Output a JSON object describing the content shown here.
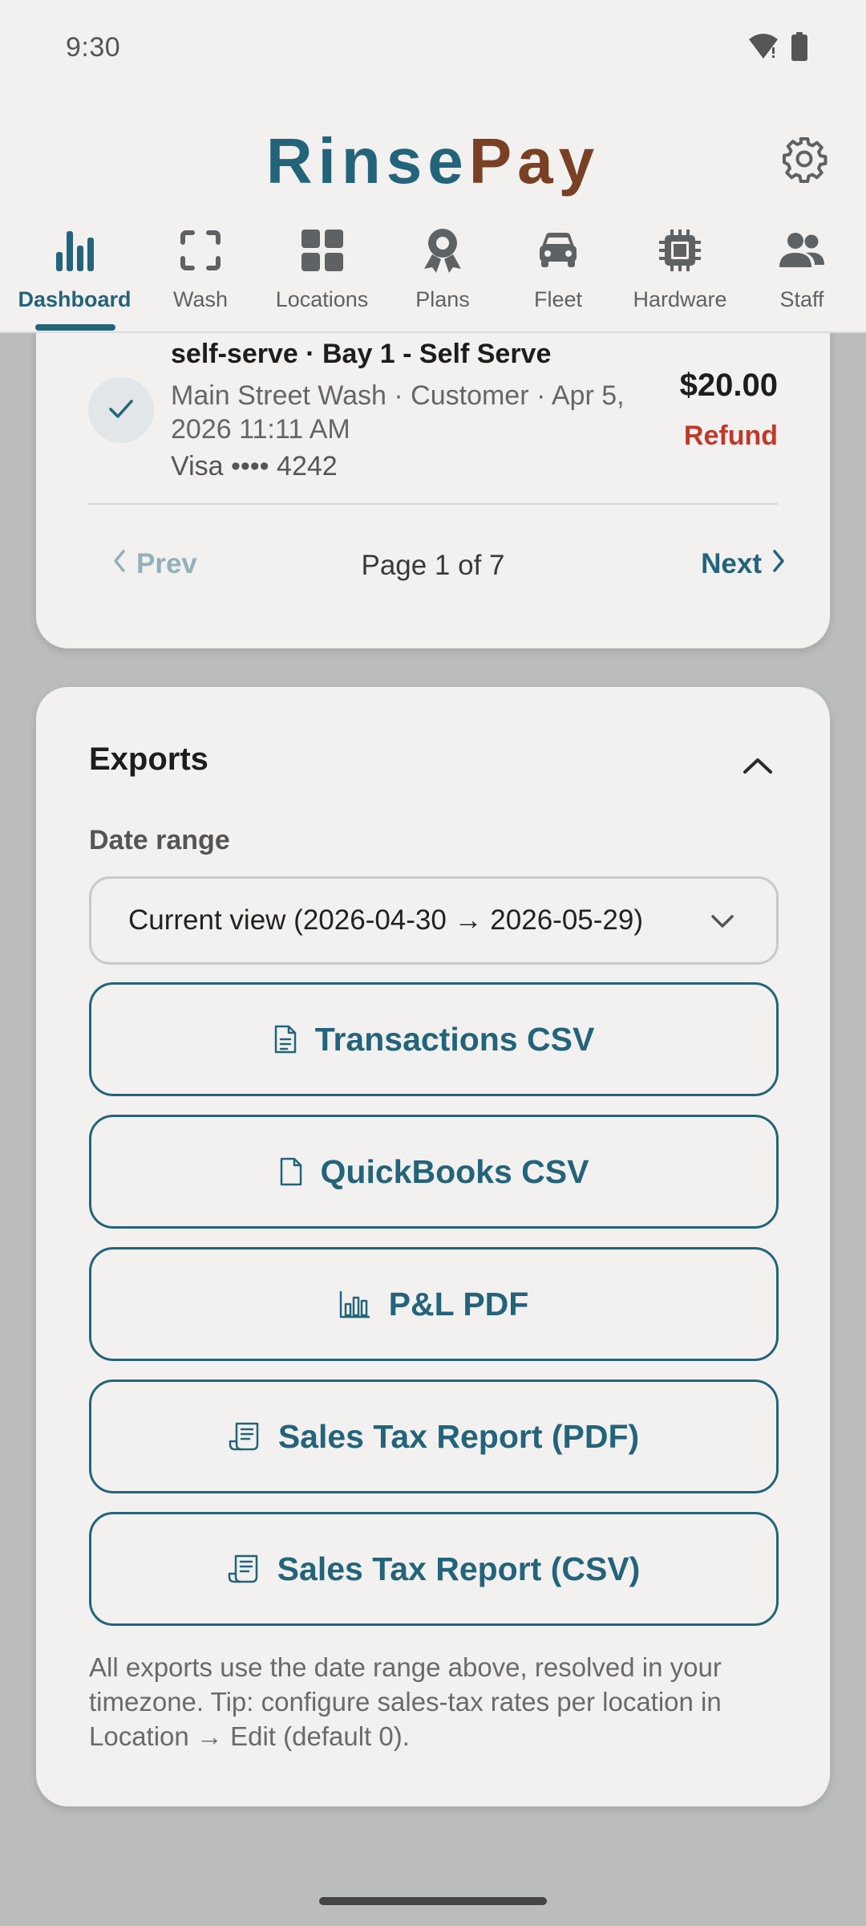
{
  "status_bar": {
    "time": "9:30"
  },
  "app": {
    "brand_part1": "Rinse",
    "brand_part2": "Pay"
  },
  "tabs": [
    {
      "label": "Dashboard",
      "icon": "bar-chart-icon",
      "active": true
    },
    {
      "label": "Wash",
      "icon": "scan-frame-icon",
      "active": false
    },
    {
      "label": "Locations",
      "icon": "grid-icon",
      "active": false
    },
    {
      "label": "Plans",
      "icon": "award-icon",
      "active": false
    },
    {
      "label": "Fleet",
      "icon": "car-icon",
      "active": false
    },
    {
      "label": "Hardware",
      "icon": "chip-icon",
      "active": false
    },
    {
      "label": "Staff",
      "icon": "people-icon",
      "active": false
    }
  ],
  "transaction": {
    "title": "self-serve · Bay 1 - Self Serve",
    "meta": "Main Street Wash · Customer · Apr 5, 2026 11:11 AM",
    "card": "Visa •••• 4242",
    "amount": "$20.00",
    "action": "Refund"
  },
  "pagination": {
    "prev": "Prev",
    "label": "Page 1 of 7",
    "next": "Next"
  },
  "exports": {
    "title": "Exports",
    "range_label": "Date range",
    "range_value": "Current view (2026-04-30 → 2026-05-29)",
    "buttons": [
      {
        "label": "Transactions CSV",
        "icon": "document-lines-icon"
      },
      {
        "label": "QuickBooks CSV",
        "icon": "document-icon"
      },
      {
        "label": "P&L PDF",
        "icon": "bar-chart-outline-icon"
      },
      {
        "label": "Sales Tax Report (PDF)",
        "icon": "receipt-icon"
      },
      {
        "label": "Sales Tax Report (CSV)",
        "icon": "receipt-icon"
      }
    ],
    "note": "All exports use the date range above, resolved in your timezone. Tip: configure sales-tax rates per location in Location → Edit (default 0)."
  },
  "colors": {
    "primary": "#23647b",
    "brand_accent": "#7a4023",
    "danger": "#c0392b",
    "surface": "#f2f1f0",
    "backdrop": "#bbbcbc"
  }
}
